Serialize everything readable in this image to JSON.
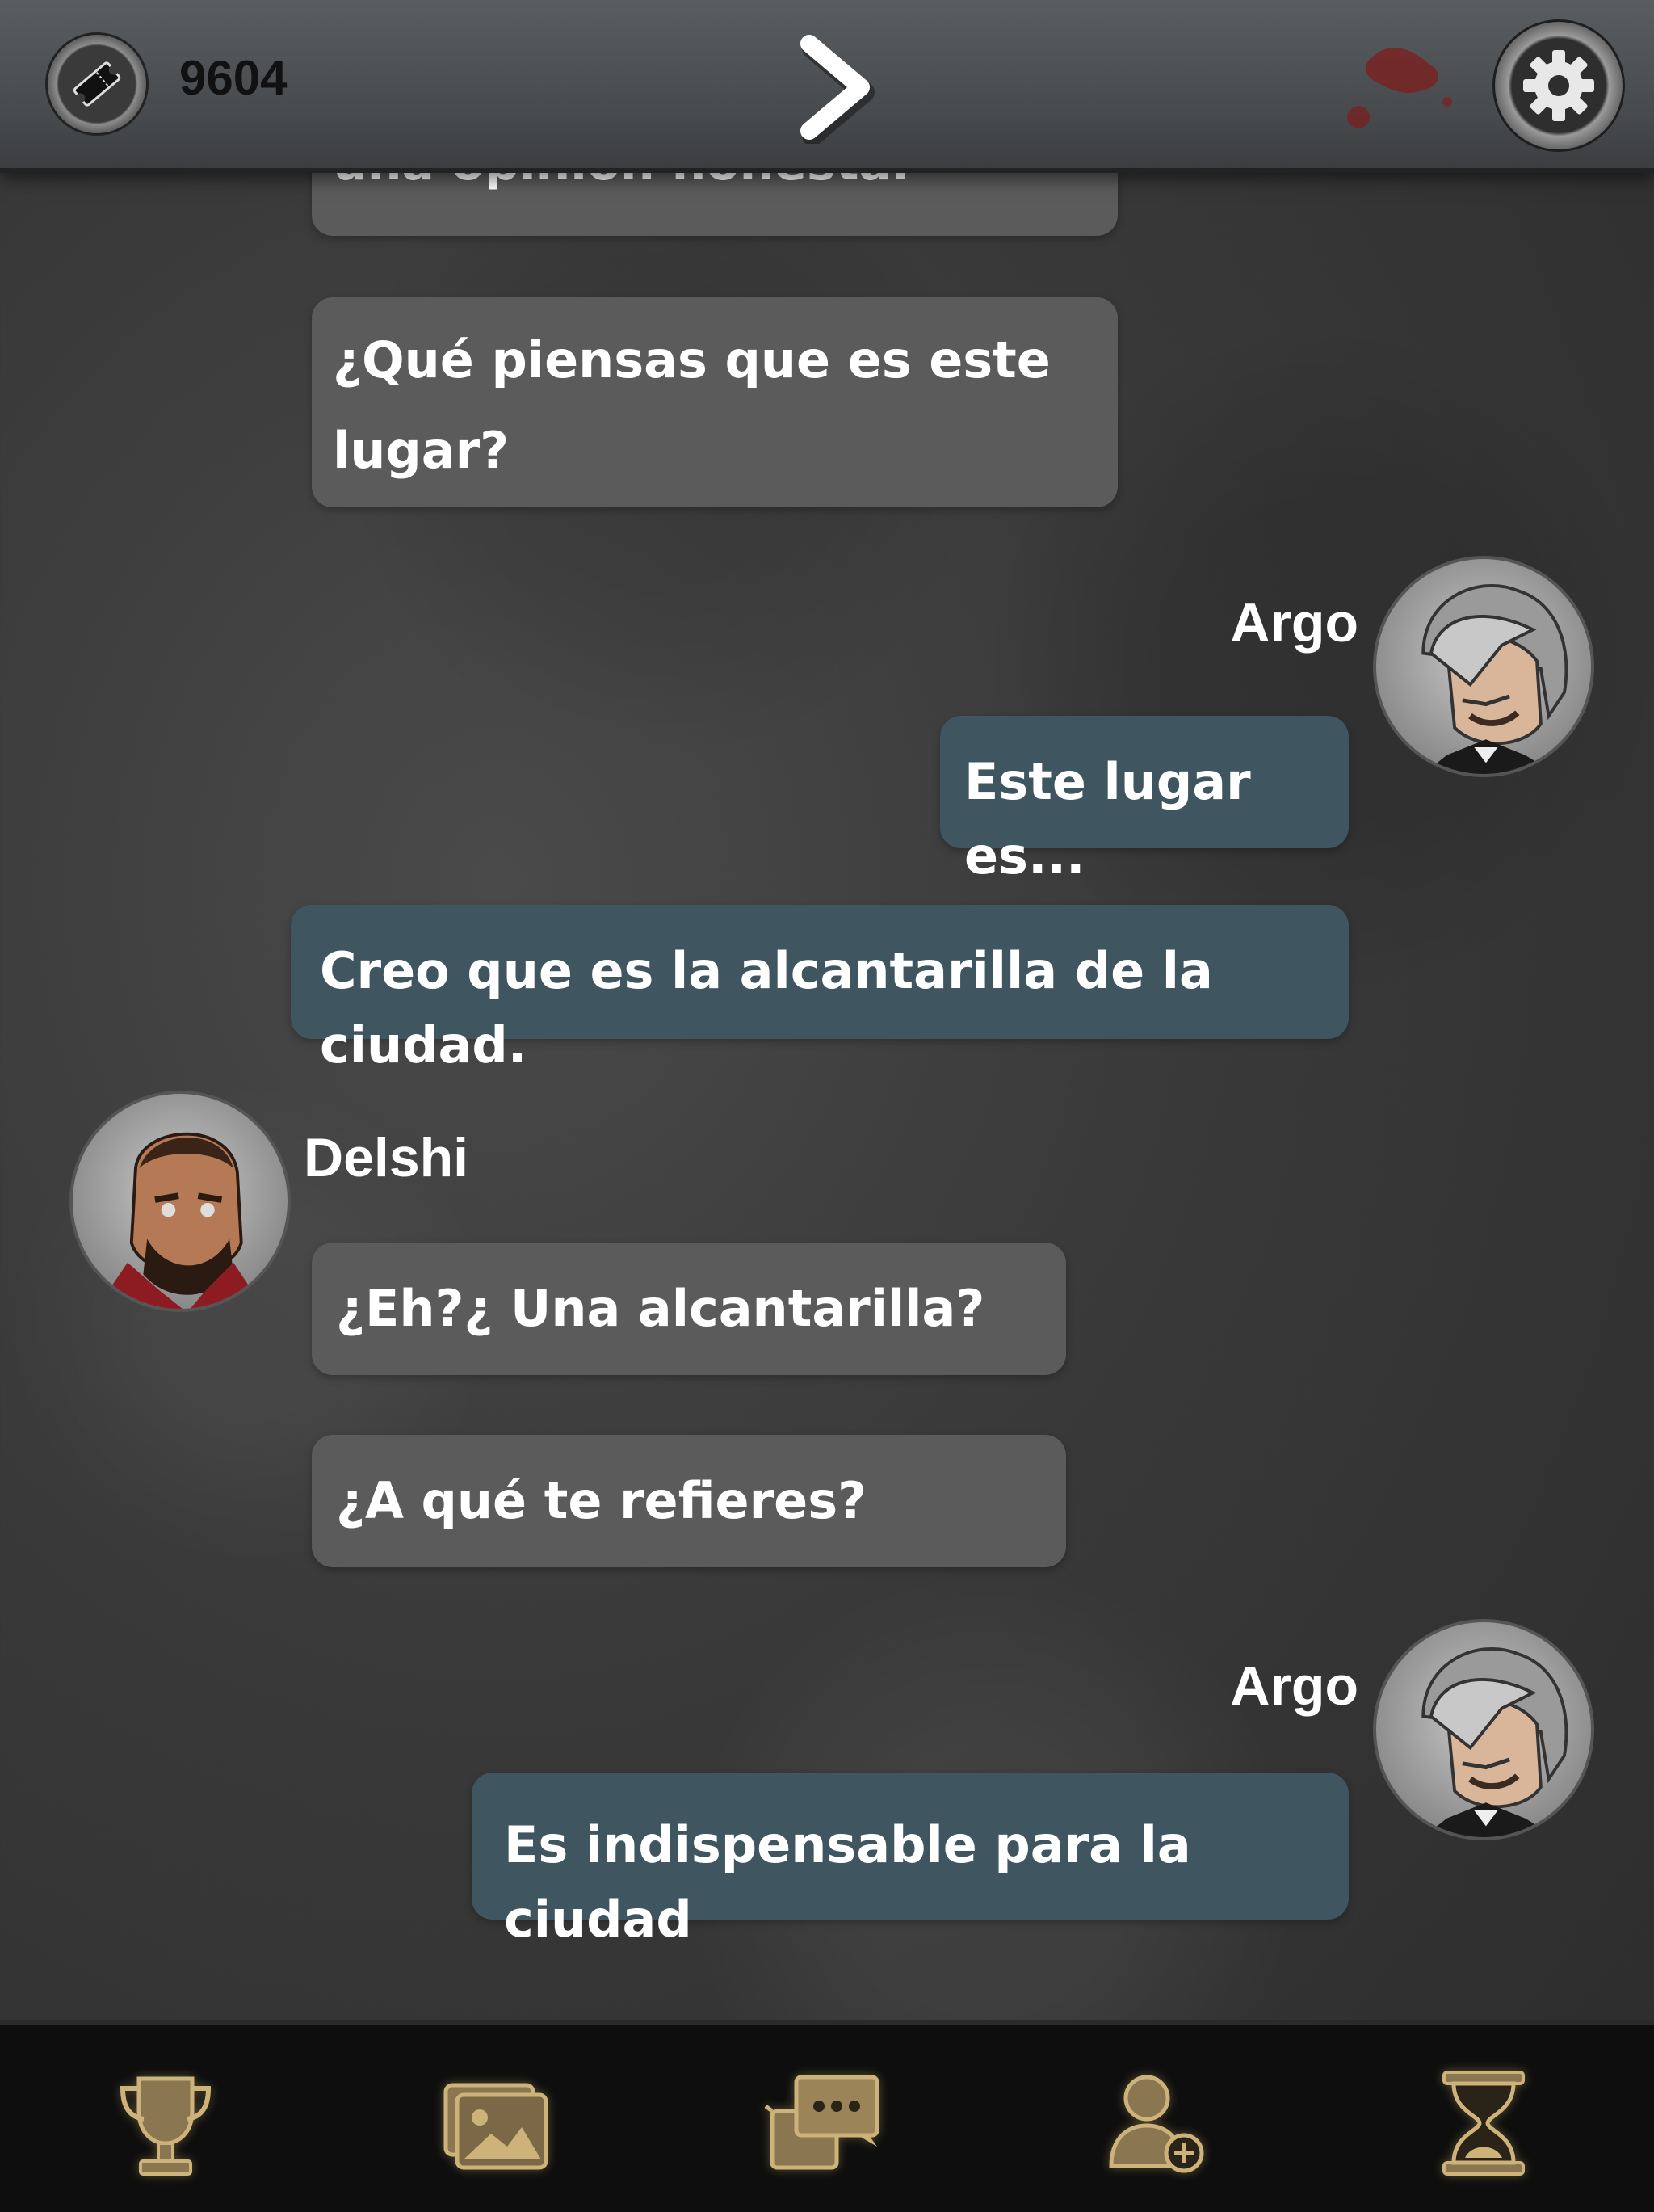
{
  "header": {
    "ticket_icon": "ticket-icon",
    "ticket_count": "9604",
    "next_icon": "chevron-right-icon",
    "settings_icon": "gear-icon"
  },
  "messages": [
    {
      "side": "left",
      "speaker": "",
      "text_lines": [
        "una opinión honesta."
      ]
    },
    {
      "side": "left",
      "speaker": "",
      "text_lines": [
        "¿Qué piensas que es este",
        "lugar?"
      ]
    },
    {
      "side": "right",
      "speaker": "Argo",
      "text_lines": [
        "Este lugar es..."
      ]
    },
    {
      "side": "right",
      "speaker": "",
      "text_lines": [
        "Creo que es la alcantarilla de la ciudad."
      ]
    },
    {
      "side": "left",
      "speaker": "Delshi",
      "text_lines": [
        "¿Eh?¿ Una alcantarilla?"
      ]
    },
    {
      "side": "left",
      "speaker": "",
      "text_lines": [
        "¿A qué te refieres?"
      ]
    },
    {
      "side": "right",
      "speaker": "Argo",
      "text_lines": [
        "Es indispensable para la ciudad"
      ]
    }
  ],
  "bottom_nav": [
    {
      "icon": "trophy-icon"
    },
    {
      "icon": "gallery-icon"
    },
    {
      "icon": "chat-icon"
    },
    {
      "icon": "add-user-icon"
    },
    {
      "icon": "hourglass-icon"
    }
  ],
  "colors": {
    "left_bubble": "#5b5b5b",
    "right_bubble": "#3f5660",
    "nav_icon": "#cdb27a"
  }
}
